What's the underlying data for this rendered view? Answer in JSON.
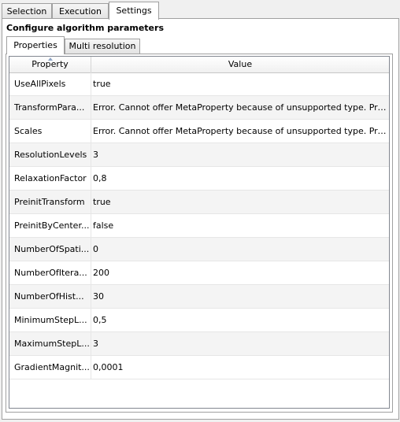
{
  "tabs": [
    "Selection",
    "Execution",
    "Settings"
  ],
  "section_title": "Configure algorithm parameters",
  "sub_tabs": [
    "Properties",
    "Multi resolution"
  ],
  "table": {
    "headers": [
      "Property",
      "Value"
    ],
    "rows": [
      {
        "property": "UseAllPixels",
        "value": "true"
      },
      {
        "property": "TransformPara...",
        "value": "Error. Cannot offer MetaProperty because of unsupported type. Prop..."
      },
      {
        "property": "Scales",
        "value": "Error. Cannot offer MetaProperty because of unsupported type. Prop..."
      },
      {
        "property": "ResolutionLevels",
        "value": "3"
      },
      {
        "property": "RelaxationFactor",
        "value": "0,8"
      },
      {
        "property": "PreinitTransform",
        "value": "true"
      },
      {
        "property": "PreinitByCenter...",
        "value": "false"
      },
      {
        "property": "NumberOfSpati...",
        "value": "0"
      },
      {
        "property": "NumberOfItera...",
        "value": "200"
      },
      {
        "property": "NumberOfHist...",
        "value": "30"
      },
      {
        "property": "MinimumStepL...",
        "value": "0,5"
      },
      {
        "property": "MaximumStepL...",
        "value": "3"
      },
      {
        "property": "GradientMagnit...",
        "value": "0,0001"
      }
    ]
  }
}
